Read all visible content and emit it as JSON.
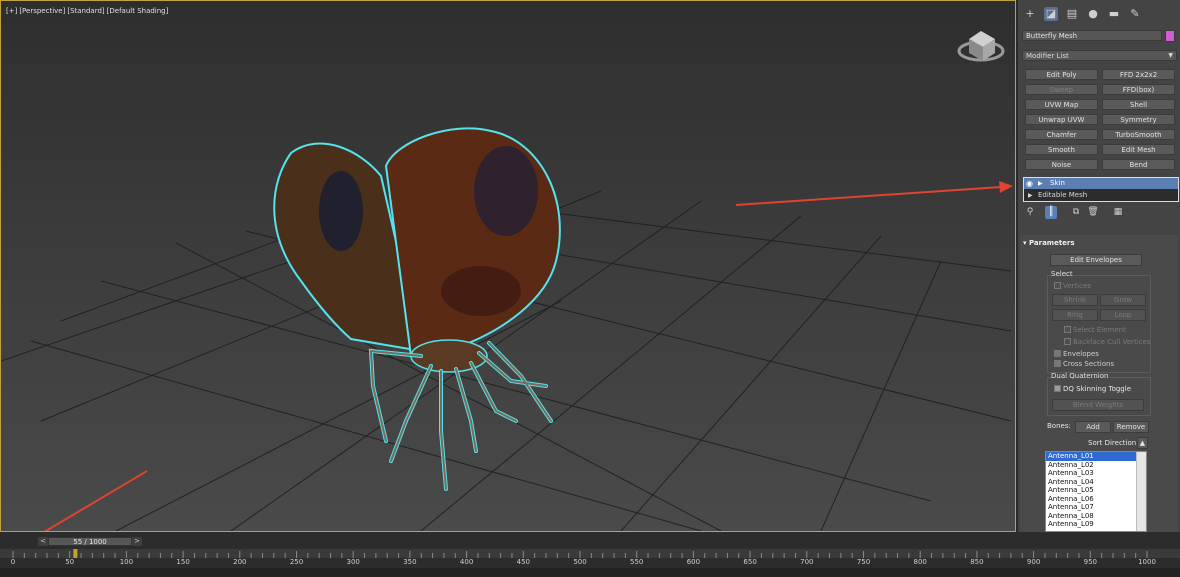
{
  "viewport": {
    "labels": [
      "[+]",
      "[Perspective]",
      "[Standard]",
      "[Default Shading]"
    ]
  },
  "command_panel": {
    "tabs": [
      {
        "name": "create-tab",
        "icon": "plus-icon"
      },
      {
        "name": "modify-tab",
        "icon": "modify-icon",
        "active": true
      },
      {
        "name": "hierarchy-tab",
        "icon": "hierarchy-icon"
      },
      {
        "name": "motion-tab",
        "icon": "motion-icon"
      },
      {
        "name": "display-tab",
        "icon": "display-icon"
      },
      {
        "name": "utilities-tab",
        "icon": "wrench-icon"
      }
    ],
    "object_name": "Butterfly Mesh",
    "object_color": "#d05fd6",
    "modifier_list": "Modifier List",
    "modifier_buttons": [
      {
        "label": "Edit Poly",
        "enabled": true
      },
      {
        "label": "FFD 2x2x2",
        "enabled": true
      },
      {
        "label": "Sweep",
        "enabled": false
      },
      {
        "label": "FFD(box)",
        "enabled": true
      },
      {
        "label": "UVW Map",
        "enabled": true
      },
      {
        "label": "Shell",
        "enabled": true
      },
      {
        "label": "Unwrap UVW",
        "enabled": true
      },
      {
        "label": "Symmetry",
        "enabled": true
      },
      {
        "label": "Chamfer",
        "enabled": true
      },
      {
        "label": "TurboSmooth",
        "enabled": true
      },
      {
        "label": "Smooth",
        "enabled": true
      },
      {
        "label": "Edit Mesh",
        "enabled": true
      },
      {
        "label": "Noise",
        "enabled": true
      },
      {
        "label": "Bend",
        "enabled": true
      }
    ],
    "stack": [
      {
        "label": "Skin",
        "selected": true
      },
      {
        "label": "Editable Mesh",
        "selected": false
      }
    ]
  },
  "parameters": {
    "title": "Parameters",
    "edit_envelopes": "Edit Envelopes",
    "select_group": "Select",
    "vertices": "Vertices",
    "shrink": "Shrink",
    "grow": "Grow",
    "ring": "Ring",
    "loop": "Loop",
    "select_element": "Select Element",
    "backface": "Backface Cull Vertices",
    "envelopes": "Envelopes",
    "cross_sections": "Cross Sections",
    "dual_quaternion": "Dual Quaternion",
    "dq_toggle": "DQ Skinning Toggle",
    "blend_weights": "Blend Weights",
    "bones_label": "Bones:",
    "add": "Add",
    "remove": "Remove",
    "sort_direction": "Sort Direction:",
    "bones": [
      "Antenna_L01",
      "Antenna_L02",
      "Antenna_L03",
      "Antenna_L04",
      "Antenna_L05",
      "Antenna_L06",
      "Antenna_L07",
      "Antenna_L08",
      "Antenna_L09"
    ],
    "selected_bone": "Antenna_L01"
  },
  "timeline": {
    "slider_text": "55 / 1000",
    "prev": "<",
    "next": ">",
    "current_frame": 55,
    "total_frames": 1000,
    "ticks": [
      "0",
      "50",
      "100",
      "150",
      "200",
      "250",
      "300",
      "350",
      "400",
      "450",
      "500",
      "550",
      "600",
      "650",
      "700",
      "750",
      "800",
      "850",
      "900",
      "950",
      "1000"
    ]
  },
  "annotations": {
    "arrow_color": "#e0432f"
  }
}
